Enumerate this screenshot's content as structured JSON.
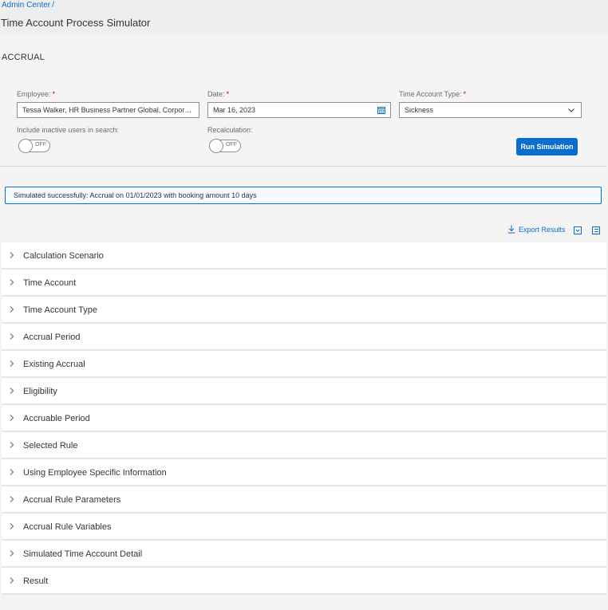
{
  "header": {
    "breadcrumb": "Admin Center",
    "breadcrumb_separator": "/",
    "title": "Time Account Process Simulator"
  },
  "section": {
    "title": "ACCRUAL"
  },
  "form": {
    "employee": {
      "label": "Employee:",
      "required": "*",
      "value": "Tessa Walker, HR Business Partner Global, Corporate..."
    },
    "date": {
      "label": "Date:",
      "required": "*",
      "value": "Mar 16, 2023",
      "icon": "calendar-icon"
    },
    "type": {
      "label": "Time Account Type:",
      "required": "*",
      "value": "Sickness",
      "icon": "chevron-down-icon"
    },
    "inactive": {
      "label": "Include inactive users in search:",
      "state": "OFF"
    },
    "recalc": {
      "label": "Recalculation:",
      "state": "OFF"
    },
    "run_button": "Run Simulation"
  },
  "message": "Simulated successfully: Accrual on 01/01/2023 with booking amount 10 days",
  "toolbar": {
    "export_label": "Export Results",
    "icons": [
      "export-icon",
      "collapse-all-icon",
      "expand-all-icon"
    ]
  },
  "panels": [
    "Calculation Scenario",
    "Time Account",
    "Time Account Type",
    "Accrual Period",
    "Existing Accrual",
    "Eligibility",
    "Accruable Period",
    "Selected Rule",
    "Using Employee Specific Information",
    "Accrual Rule Parameters",
    "Accrual Rule Variables",
    "Simulated Time Account Detail",
    "Result"
  ],
  "colors": {
    "accent": "#0a6ed1",
    "required": "#bb0000",
    "background": "#f4f4f4"
  }
}
